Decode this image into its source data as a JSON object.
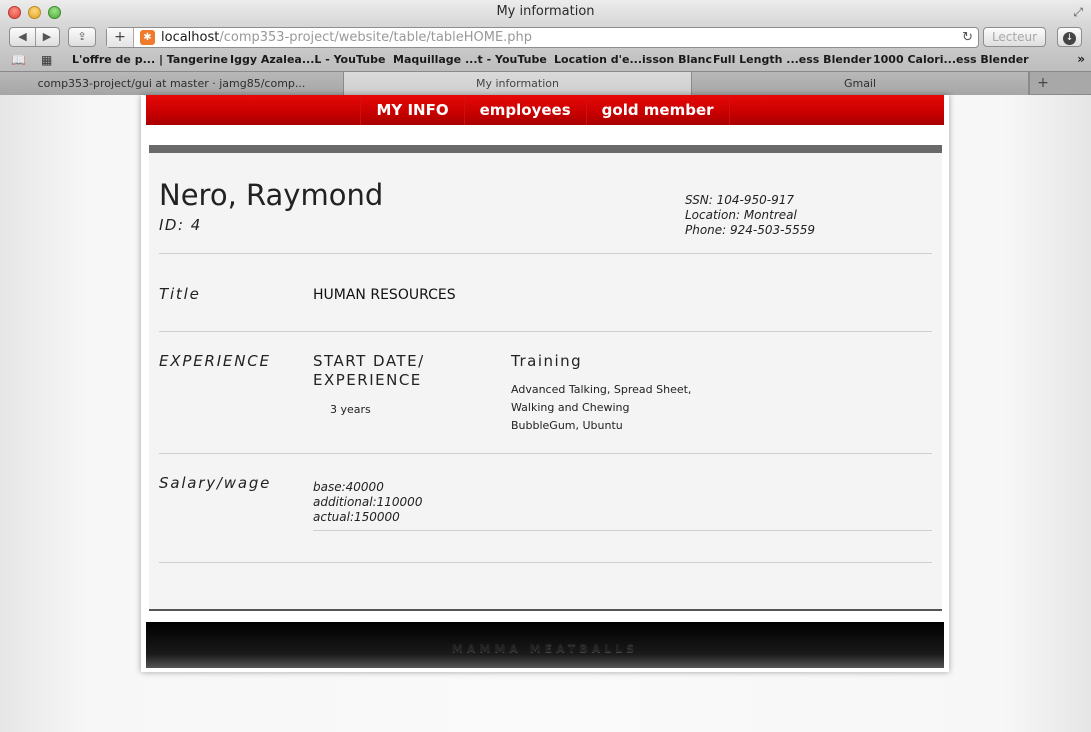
{
  "window": {
    "title": "My information"
  },
  "toolbar": {
    "url_host": "localhost",
    "url_path": "/comp353-project/website/table/tableHOME.php",
    "reader_label": "Lecteur"
  },
  "bookmarks": [
    "L'offre de p... | Tangerine",
    "Iggy Azalea...L - YouTube",
    "Maquillage ...t - YouTube",
    "Location d'e...isson Blanc",
    "Full Length ...ess Blender",
    "1000 Calori...ess Blender"
  ],
  "tabs": [
    {
      "label": "comp353-project/gui at master · jamg85/comp..."
    },
    {
      "label": "My information"
    },
    {
      "label": "Gmail"
    }
  ],
  "nav": {
    "items": [
      "MY INFO",
      "employees",
      "gold member"
    ]
  },
  "profile": {
    "name": "Nero, Raymond",
    "id_line": "ID: 4",
    "ssn": "SSN: 104-950-917",
    "location": "Location: Montreal",
    "phone": "Phone: 924-503-5559"
  },
  "sections": {
    "title_label": "Title",
    "title_value": "HUMAN RESOURCES",
    "experience_label": "EXPERIENCE",
    "start_date_heading_1": "START DATE/",
    "start_date_heading_2": "EXPERIENCE",
    "years": "3 years",
    "training_heading": "Training",
    "training_items": [
      "Advanced Talking, Spread Sheet,",
      "Walking and Chewing",
      "BubbleGum, Ubuntu"
    ],
    "salary_label": "Salary/wage",
    "salary_base": "base:40000",
    "salary_additional": "additional:110000",
    "salary_actual": "actual:150000"
  },
  "footer": {
    "text": "MAMMA MEATBALLS"
  }
}
